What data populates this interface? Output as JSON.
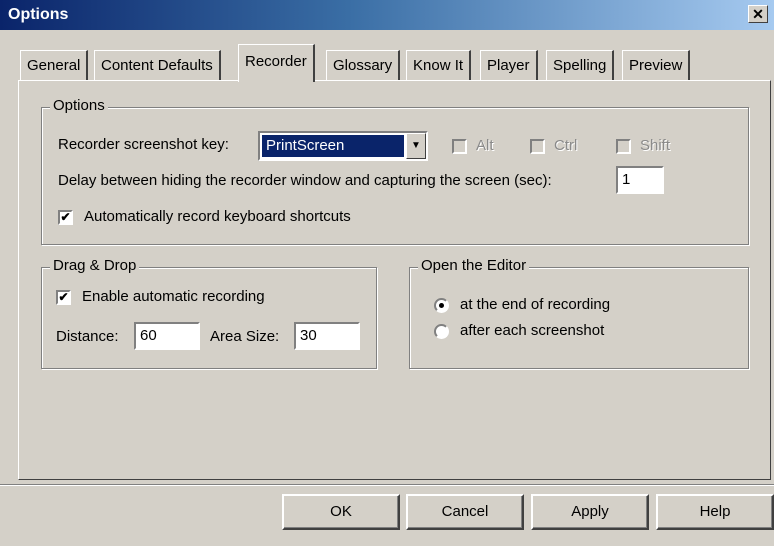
{
  "window": {
    "title": "Options",
    "close_glyph": "✕"
  },
  "tabs": [
    "General",
    "Content Defaults",
    "Recorder",
    "Glossary",
    "Know It",
    "Player",
    "Spelling",
    "Preview"
  ],
  "options_group": {
    "legend": "Options",
    "screenshot_key_label": "Recorder screenshot key:",
    "screenshot_key_value": "PrintScreen",
    "modifiers": [
      {
        "label": "Alt",
        "checked": false,
        "enabled": false
      },
      {
        "label": "Ctrl",
        "checked": false,
        "enabled": false
      },
      {
        "label": "Shift",
        "checked": false,
        "enabled": false
      }
    ],
    "delay_label": "Delay between hiding the recorder window and capturing the screen (sec):",
    "delay_value": "1",
    "auto_shortcuts_label": "Automatically record keyboard shortcuts",
    "auto_shortcuts_checked": true
  },
  "drag_drop": {
    "legend": "Drag & Drop",
    "enable_label": "Enable automatic recording",
    "enable_checked": true,
    "distance_label": "Distance:",
    "distance_value": "60",
    "area_label": "Area Size:",
    "area_value": "30"
  },
  "open_editor": {
    "legend": "Open the Editor",
    "options": [
      "at the end of recording",
      "after each screenshot"
    ],
    "selected_index": 0
  },
  "buttons": {
    "ok": "OK",
    "cancel": "Cancel",
    "apply": "Apply",
    "help": "Help"
  }
}
